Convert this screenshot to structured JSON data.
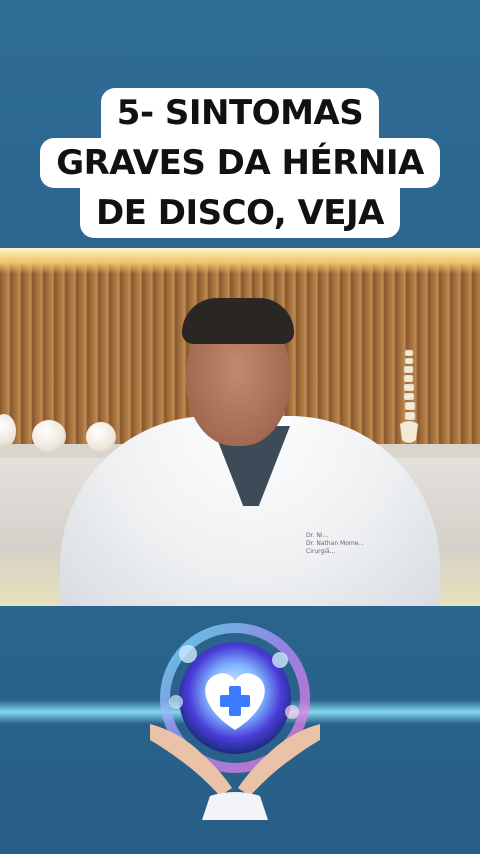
{
  "caption": {
    "lines": [
      "5- SINTOMAS",
      "GRAVES DA HÉRNIA",
      "DE DISCO, VEJA"
    ]
  },
  "video": {
    "badge_lines": [
      "Dr. Ni...",
      "Dr. Nathan Mome...",
      "Cirurgiã..."
    ]
  },
  "logo": {
    "icon": "heart-cross-icon"
  },
  "colors": {
    "background": "#2d6a94",
    "caption_bg": "#ffffff",
    "caption_text": "#111111",
    "glow": "#96ebff"
  }
}
